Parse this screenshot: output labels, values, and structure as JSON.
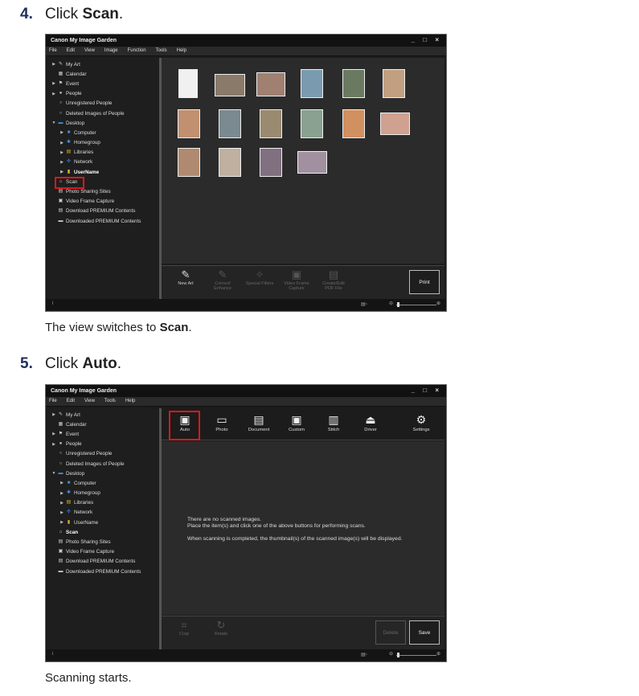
{
  "steps": [
    {
      "number": "4.",
      "prefix": "Click ",
      "target": "Scan",
      "suffix": ".",
      "caption_prefix": "The view switches to ",
      "caption_target": "Scan",
      "caption_suffix": "."
    },
    {
      "number": "5.",
      "prefix": "Click ",
      "target": "Auto",
      "suffix": ".",
      "caption": "Scanning starts."
    }
  ],
  "window": {
    "title": "Canon My Image Garden",
    "controls": "_ □ ×",
    "menu1": [
      "File",
      "Edit",
      "View",
      "Image",
      "Function",
      "Tools",
      "Help"
    ],
    "menu2": [
      "File",
      "Edit",
      "View",
      "Tools",
      "Help"
    ]
  },
  "sidebar": {
    "items": [
      "My Art",
      "Calendar",
      "Event",
      "People",
      "Unregistered People",
      "Deleted Images of People",
      "Desktop",
      "Computer",
      "Homegroup",
      "Libraries",
      "Network",
      "UserName",
      "Scan",
      "Photo Sharing Sites",
      "Video Frame Capture",
      "Download PREMIUM Contents",
      "Downloaded PREMIUM Contents"
    ]
  },
  "toolbar1": {
    "new_art": "New Art",
    "correct": "Correct/ Enhance",
    "special": "Special Filters",
    "video": "Video Frame Capture",
    "pdf": "Create/Edit PDF File",
    "print": "Print"
  },
  "scan_buttons": [
    "Auto",
    "Photo",
    "Document",
    "Custom",
    "Stitch",
    "Driver",
    "Settings"
  ],
  "scan_message": {
    "line1": "There are no scanned images.",
    "line2": "Place the item(s) and click one of the above buttons for performing scans.",
    "line3": "When scanning is completed, the thumbnail(s) of the scanned image(s) will be displayed."
  },
  "toolbar2": {
    "crop": "Crop",
    "rotate": "Rotate",
    "delete": "Delete",
    "save": "Save"
  },
  "colors": {
    "highlight": "#e0151a",
    "step_number": "#1f2f5a"
  }
}
